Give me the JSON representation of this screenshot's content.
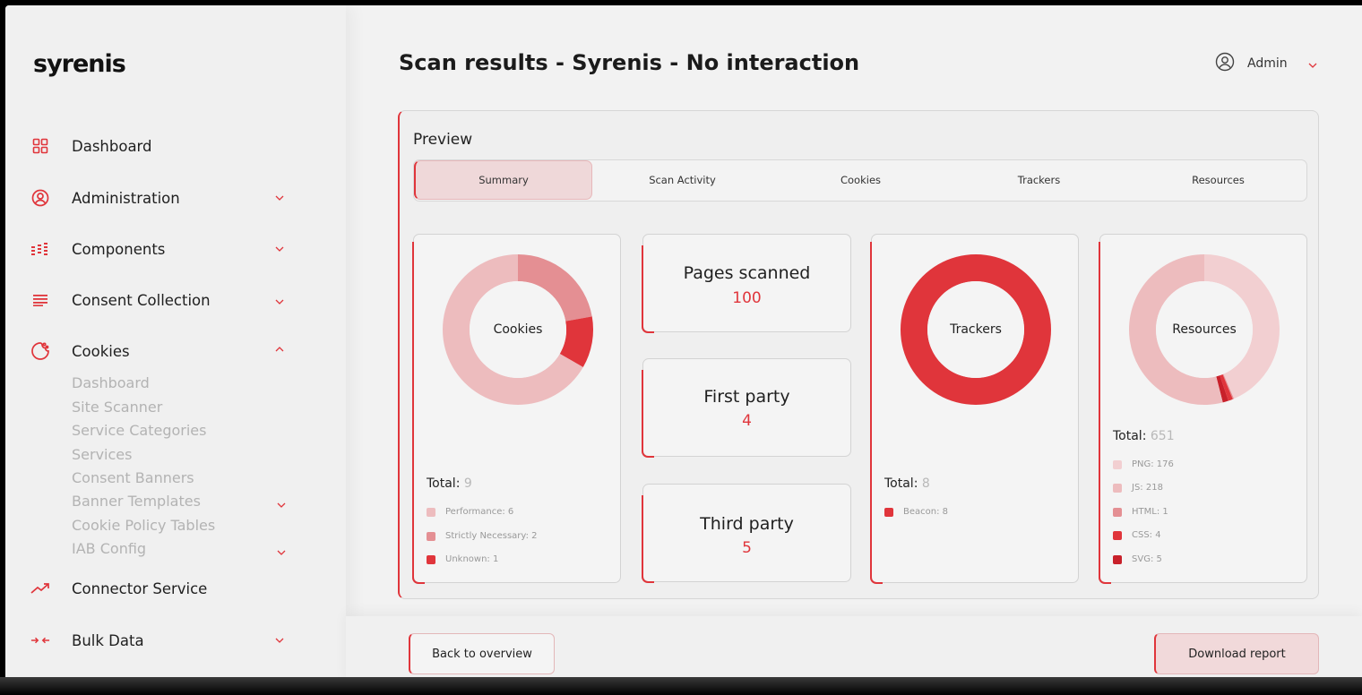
{
  "brand": {
    "logo": "syrenis",
    "accent": "#e0353b"
  },
  "header": {
    "title": "Scan results - Syrenis - No interaction",
    "user": "Admin"
  },
  "sidebar": {
    "items": [
      {
        "label": "Dashboard",
        "icon": "grid-icon",
        "chevron": ""
      },
      {
        "label": "Administration",
        "icon": "user-circle-icon",
        "chevron": "down"
      },
      {
        "label": "Components",
        "icon": "components-icon",
        "chevron": "down"
      },
      {
        "label": "Consent Collection",
        "icon": "lines-icon",
        "chevron": "down"
      },
      {
        "label": "Cookies",
        "icon": "cookie-icon",
        "chevron": "up"
      },
      {
        "label": "Connector Service",
        "icon": "trend-icon",
        "chevron": ""
      },
      {
        "label": "Bulk Data",
        "icon": "arrows-icon",
        "chevron": "down"
      }
    ],
    "cookies_sub": [
      "Dashboard",
      "Site Scanner",
      "Service Categories",
      "Services",
      "Consent Banners",
      "Banner Templates",
      "Cookie Policy Tables",
      "IAB Config"
    ]
  },
  "preview": {
    "label": "Preview",
    "tabs": [
      "Summary",
      "Scan Activity",
      "Cookies",
      "Trackers",
      "Resources"
    ],
    "active_tab": "Summary"
  },
  "cookies_card": {
    "center": "Cookies",
    "total_label": "Total:",
    "total": "9",
    "legend": [
      {
        "label": "Performance: 6",
        "value": 6,
        "color": "#edbcbe"
      },
      {
        "label": "Strictly Necessary: 2",
        "value": 2,
        "color": "#e48f93"
      },
      {
        "label": "Unknown: 1",
        "value": 1,
        "color": "#e0353b"
      }
    ]
  },
  "stats": [
    {
      "label": "Pages scanned",
      "value": "100"
    },
    {
      "label": "First party",
      "value": "4"
    },
    {
      "label": "Third party",
      "value": "5"
    }
  ],
  "trackers_card": {
    "center": "Trackers",
    "total_label": "Total:",
    "total": "8",
    "legend": [
      {
        "label": "Beacon: 8",
        "value": 8,
        "color": "#e0353b"
      }
    ]
  },
  "resources_card": {
    "center": "Resources",
    "total_label": "Total:",
    "total": "651",
    "legend": [
      {
        "label": "PNG: 176",
        "value": 176,
        "color": "#f2cfd1"
      },
      {
        "label": "JS: 218",
        "value": 218,
        "color": "#edbcbe"
      },
      {
        "label": "HTML: 1",
        "value": 1,
        "color": "#e48f93"
      },
      {
        "label": "CSS: 4",
        "value": 4,
        "color": "#e0353b"
      },
      {
        "label": "SVG: 5",
        "value": 5,
        "color": "#c8202a"
      }
    ]
  },
  "buttons": {
    "back": "Back to overview",
    "download": "Download report"
  }
}
